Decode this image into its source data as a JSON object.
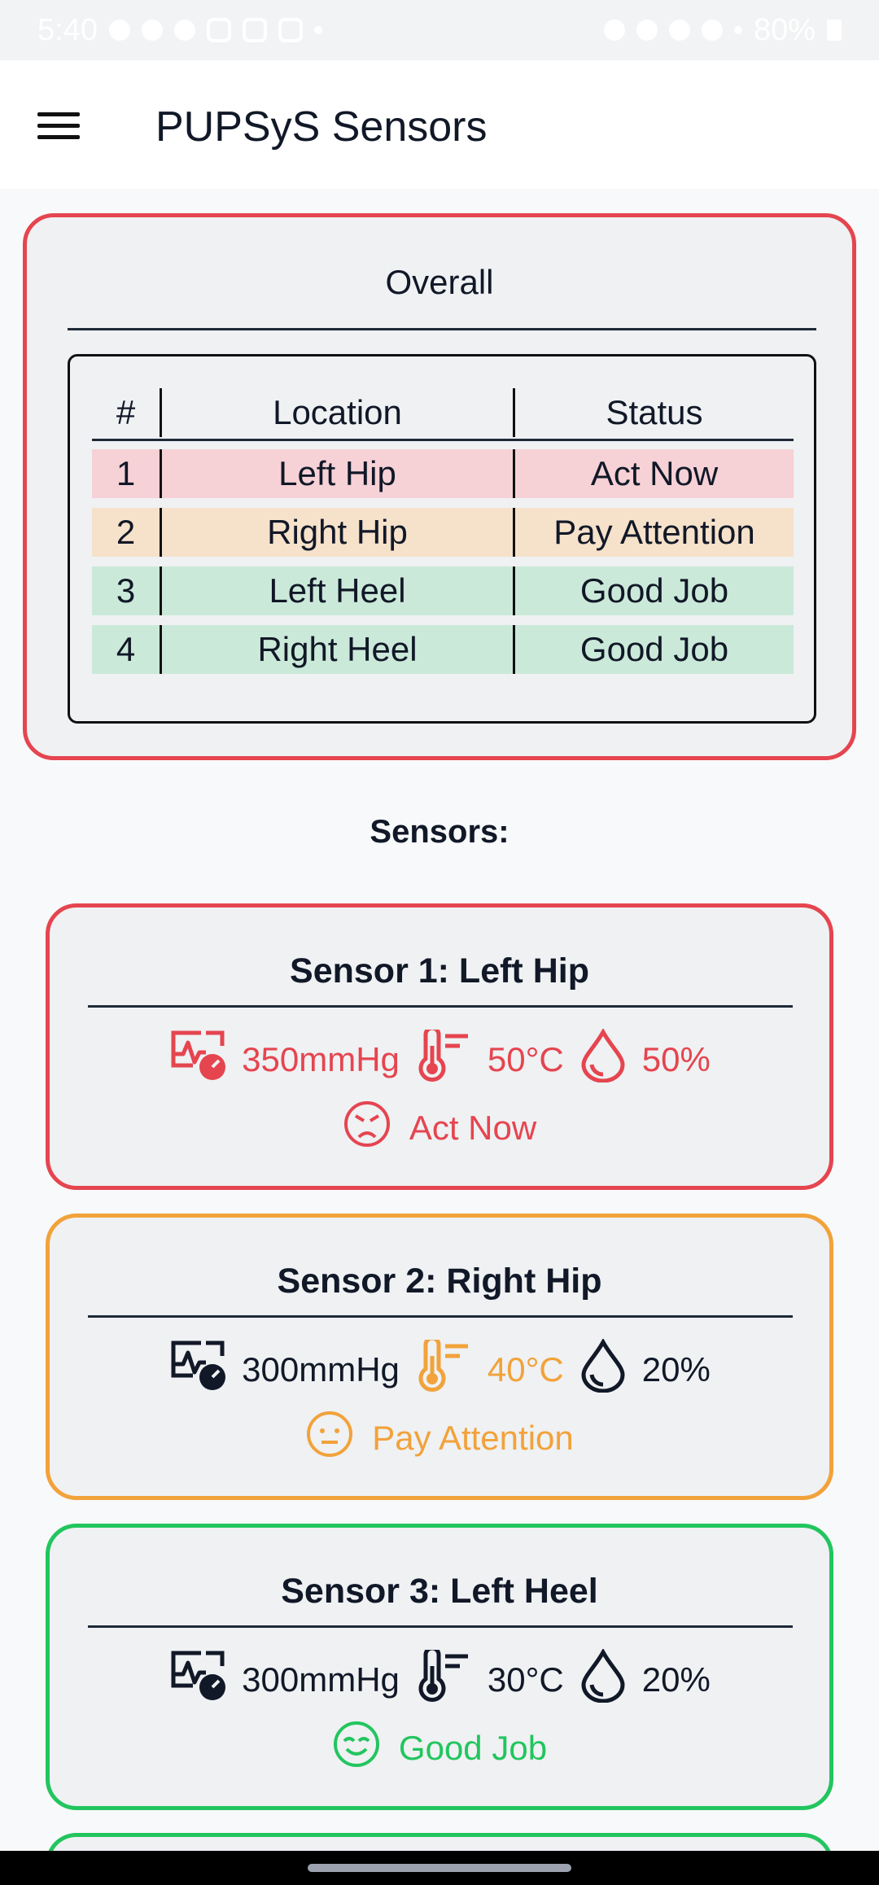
{
  "status_bar": {
    "time": "5:40",
    "battery": "80%"
  },
  "app": {
    "title": "PUPSyS Sensors"
  },
  "overall": {
    "title": "Overall",
    "headers": [
      "#",
      "Location",
      "Status"
    ],
    "rows": [
      {
        "num": "1",
        "location": "Left Hip",
        "status": "Act Now",
        "bg": "#f6d1d6"
      },
      {
        "num": "2",
        "location": "Right Hip",
        "status": "Pay Attention",
        "bg": "#f6e1ca"
      },
      {
        "num": "3",
        "location": "Left Heel",
        "status": "Good Job",
        "bg": "#cbe9d9"
      },
      {
        "num": "4",
        "location": "Right Heel",
        "status": "Good Job",
        "bg": "#cbe9d9"
      }
    ]
  },
  "sensors_heading": "Sensors:",
  "sensors": [
    {
      "title": "Sensor 1: Left Hip",
      "pressure": "350mmHg",
      "temperature": "50°C",
      "humidity": "50%",
      "status": "Act Now",
      "border": "#e5454f",
      "pressure_color": "#e5454f",
      "temp_color": "#e5454f",
      "humidity_color": "#e5454f",
      "status_color": "#e5454f",
      "face": "angry-face-icon"
    },
    {
      "title": "Sensor 2: Right Hip",
      "pressure": "300mmHg",
      "temperature": "40°C",
      "humidity": "20%",
      "status": "Pay Attention",
      "border": "#f2a23a",
      "pressure_color": "#111827",
      "temp_color": "#f2a23a",
      "humidity_color": "#111827",
      "status_color": "#f2a23a",
      "face": "neutral-face-icon"
    },
    {
      "title": "Sensor 3: Left Heel",
      "pressure": "300mmHg",
      "temperature": "30°C",
      "humidity": "20%",
      "status": "Good Job",
      "border": "#22c55e",
      "pressure_color": "#111827",
      "temp_color": "#111827",
      "humidity_color": "#111827",
      "status_color": "#22c55e",
      "face": "happy-face-icon"
    }
  ]
}
